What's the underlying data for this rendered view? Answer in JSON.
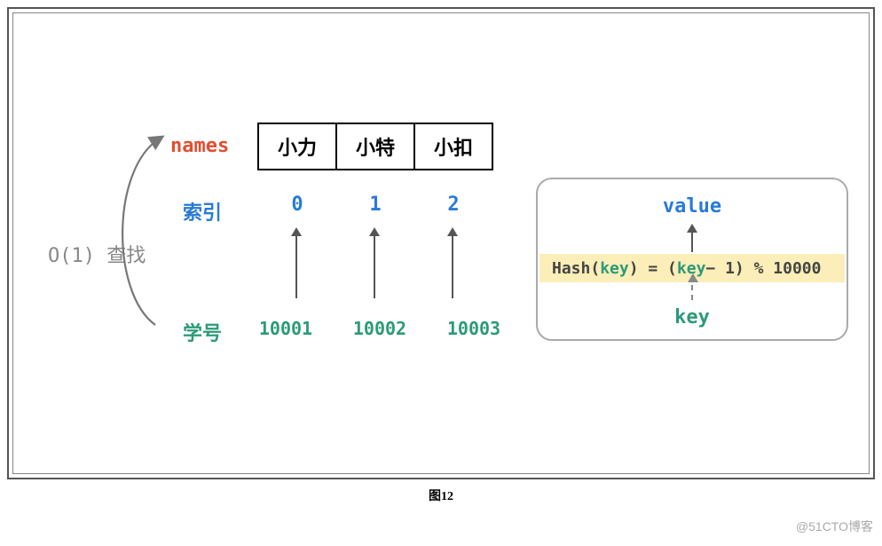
{
  "labels": {
    "names": "names",
    "index": "索引",
    "student_id": "学号",
    "lookup": "O(1) 查找"
  },
  "cells": [
    "小力",
    "小特",
    "小扣"
  ],
  "indices": [
    "0",
    "1",
    "2"
  ],
  "ids": [
    "10001",
    "10002",
    "10003"
  ],
  "hash": {
    "value_label": "value",
    "key_label": "key",
    "formula_prefix": "Hash(",
    "formula_key1": "key",
    "formula_mid": ") = (",
    "formula_key2": "key",
    "formula_suffix": " − 1) % 10000"
  },
  "caption": "图12",
  "watermark": "@51CTO博客"
}
